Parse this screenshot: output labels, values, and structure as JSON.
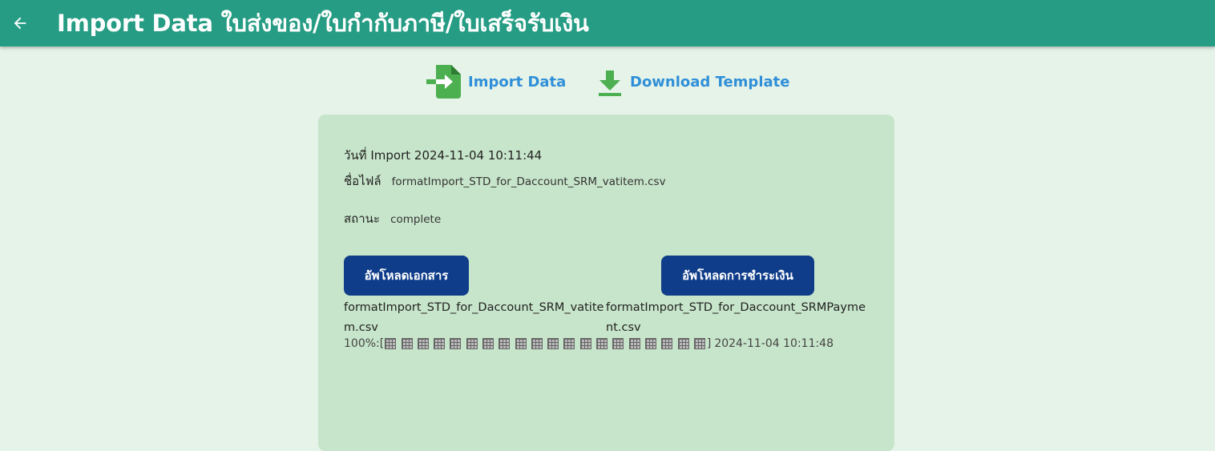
{
  "appbar": {
    "title": "Import Data ใบส่งของ/ใบกำกับภาษี/ใบเสร็จรับเงิน",
    "back_icon": "arrow-left-icon"
  },
  "actions": {
    "import_label": "Import Data",
    "import_icon": "file-import-icon",
    "download_label": "Download Template",
    "download_icon": "download-icon"
  },
  "card": {
    "import_date_label": "วันที่ Import",
    "import_date_value": "2024-11-04 10:11:44",
    "file_label": "ชื่อไฟล์",
    "file_value": "formatImport_STD_for_Daccount_SRM_vatitem.csv",
    "status_label": "สถานะ",
    "status_value": "complete",
    "upload_doc_label": "อัพโหลดเอกสาร",
    "upload_payment_label": "อัพโหลดการชำระเงิน",
    "doc_filename": "formatImport_STD_for_Daccount_SRM_vatitem.csv",
    "payment_filename": "formatImport_STD_for_Daccount_SRMPayment.csv",
    "progress_percent": "100%:[",
    "progress_value": 100,
    "progress_blocks": 20,
    "progress_close": "]",
    "progress_time": "2024-11-04 10:11:48"
  },
  "colors": {
    "appbar": "#259c83",
    "background": "#e6f3e8",
    "card": "#c7e5ca",
    "link": "#2f8fd8",
    "button": "#0f3d8a",
    "icon_green": "#4caf50"
  }
}
